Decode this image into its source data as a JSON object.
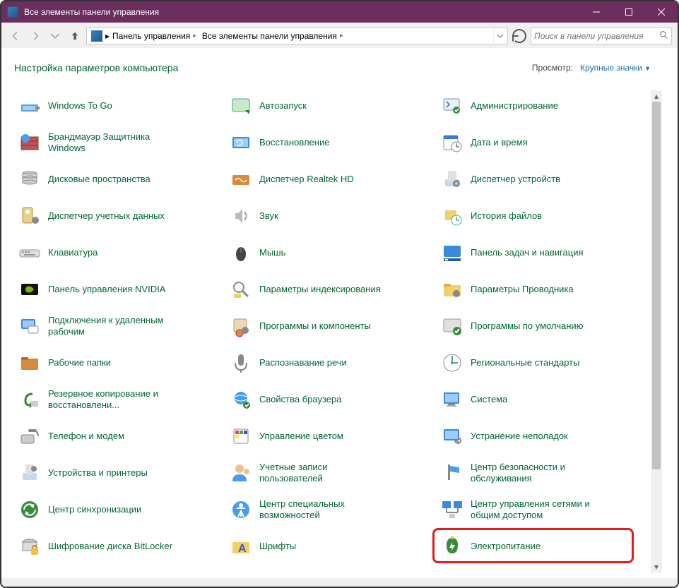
{
  "window": {
    "title": "Все элементы панели управления"
  },
  "breadcrumb": {
    "root": "Панель управления",
    "current": "Все элементы панели управления"
  },
  "search": {
    "placeholder": "Поиск в панели управления"
  },
  "header": {
    "title": "Настройка параметров компьютера",
    "view_label": "Просмотр:",
    "view_value": "Крупные значки"
  },
  "items": [
    {
      "label": "Windows To Go",
      "icon": "usb"
    },
    {
      "label": "Автозапуск",
      "icon": "autoplay"
    },
    {
      "label": "Администрирование",
      "icon": "admin"
    },
    {
      "label": "Брандмауэр Защитника Windows",
      "icon": "firewall"
    },
    {
      "label": "Восстановление",
      "icon": "recovery"
    },
    {
      "label": "Дата и время",
      "icon": "datetime"
    },
    {
      "label": "Дисковые пространства",
      "icon": "storage"
    },
    {
      "label": "Диспетчер Realtek HD",
      "icon": "realtek"
    },
    {
      "label": "Диспетчер устройств",
      "icon": "devmgr"
    },
    {
      "label": "Диспетчер учетных данных",
      "icon": "credmgr"
    },
    {
      "label": "Звук",
      "icon": "sound"
    },
    {
      "label": "История файлов",
      "icon": "filehist"
    },
    {
      "label": "Клавиатура",
      "icon": "keyboard"
    },
    {
      "label": "Мышь",
      "icon": "mouse"
    },
    {
      "label": "Панель задач и навигация",
      "icon": "taskbar"
    },
    {
      "label": "Панель управления NVIDIA",
      "icon": "nvidia"
    },
    {
      "label": "Параметры индексирования",
      "icon": "indexing"
    },
    {
      "label": "Параметры Проводника",
      "icon": "explorer"
    },
    {
      "label": "Подключения к удаленным рабочим",
      "icon": "remote"
    },
    {
      "label": "Программы и компоненты",
      "icon": "programs"
    },
    {
      "label": "Программы по умолчанию",
      "icon": "defaults"
    },
    {
      "label": "Рабочие папки",
      "icon": "workfolders"
    },
    {
      "label": "Распознавание речи",
      "icon": "speech"
    },
    {
      "label": "Региональные стандарты",
      "icon": "region"
    },
    {
      "label": "Резервное копирование и восстановлени...",
      "icon": "backup"
    },
    {
      "label": "Свойства браузера",
      "icon": "inetopt"
    },
    {
      "label": "Система",
      "icon": "system"
    },
    {
      "label": "Телефон и модем",
      "icon": "phone"
    },
    {
      "label": "Управление цветом",
      "icon": "color"
    },
    {
      "label": "Устранение неполадок",
      "icon": "troubleshoot"
    },
    {
      "label": "Устройства и принтеры",
      "icon": "devices"
    },
    {
      "label": "Учетные записи пользователей",
      "icon": "users"
    },
    {
      "label": "Центр безопасности и обслуживания",
      "icon": "security"
    },
    {
      "label": "Центр синхронизации",
      "icon": "sync"
    },
    {
      "label": "Центр специальных возможностей",
      "icon": "ease"
    },
    {
      "label": "Центр управления сетями и общим доступом",
      "icon": "network"
    },
    {
      "label": "Шифрование диска BitLocker",
      "icon": "bitlocker"
    },
    {
      "label": "Шрифты",
      "icon": "fonts"
    },
    {
      "label": "Электропитание",
      "icon": "power",
      "highlighted": true
    }
  ]
}
